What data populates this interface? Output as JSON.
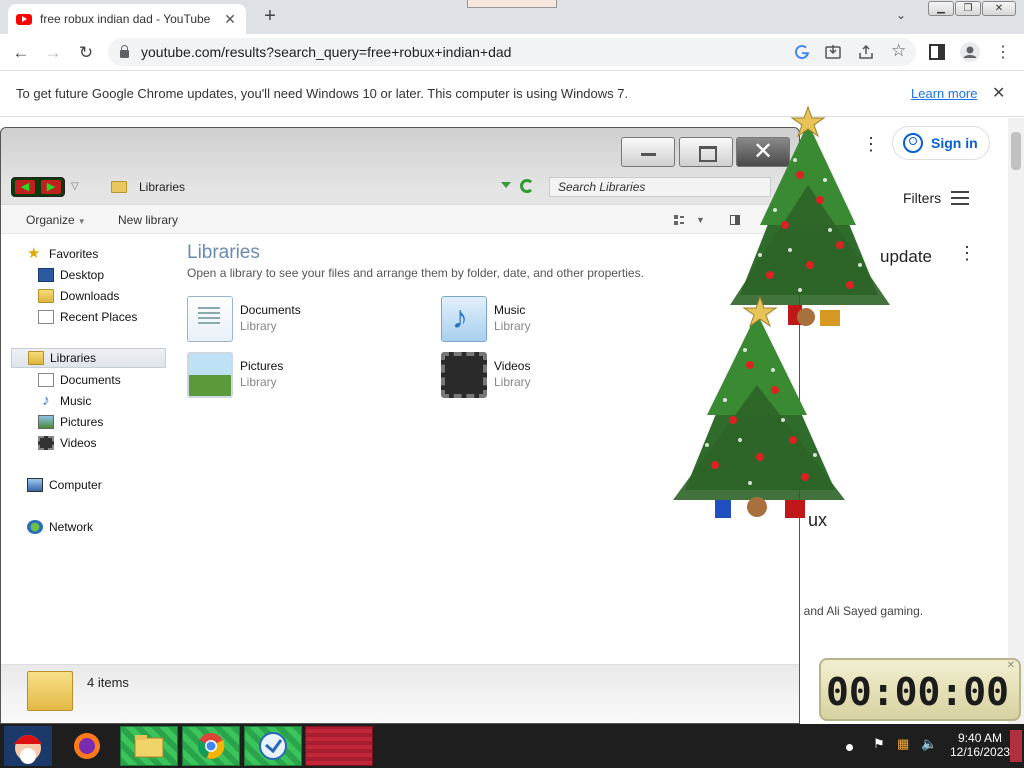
{
  "chrome": {
    "tab_title": "free robux indian dad - YouTube",
    "tab_close": "✕",
    "new_tab": "+",
    "url": "youtube.com/results?search_query=free+robux+indian+dad",
    "infobar_message": "To get future Google Chrome updates, you'll need Windows 10 or later. This computer is using Windows 7.",
    "infobar_link": "Learn more",
    "infobar_close": "✕"
  },
  "youtube": {
    "sign_in": "Sign in",
    "filters": "Filters",
    "partial_title": "update",
    "partial_text": "ux",
    "partial_channel": "t and Ali Sayed gaming."
  },
  "explorer": {
    "breadcrumb": "Libraries",
    "search_placeholder": "Search Libraries",
    "cmd_organize": "Organize",
    "cmd_new_library": "New library",
    "nav": {
      "favorites": "Favorites",
      "desktop": "Desktop",
      "downloads": "Downloads",
      "recent_places": "Recent Places",
      "libraries": "Libraries",
      "documents": "Documents",
      "music": "Music",
      "pictures": "Pictures",
      "videos": "Videos",
      "computer": "Computer",
      "network": "Network"
    },
    "heading": "Libraries",
    "subheading": "Open a library to see your files and arrange them by folder, date, and other properties.",
    "libraries": [
      {
        "name": "Documents",
        "type": "Library"
      },
      {
        "name": "Music",
        "type": "Library"
      },
      {
        "name": "Pictures",
        "type": "Library"
      },
      {
        "name": "Videos",
        "type": "Library"
      }
    ],
    "item_count": "4 items"
  },
  "clock": {
    "time": "00:00:00"
  },
  "taskbar": {
    "time": "9:40 AM",
    "date": "12/16/2023"
  }
}
